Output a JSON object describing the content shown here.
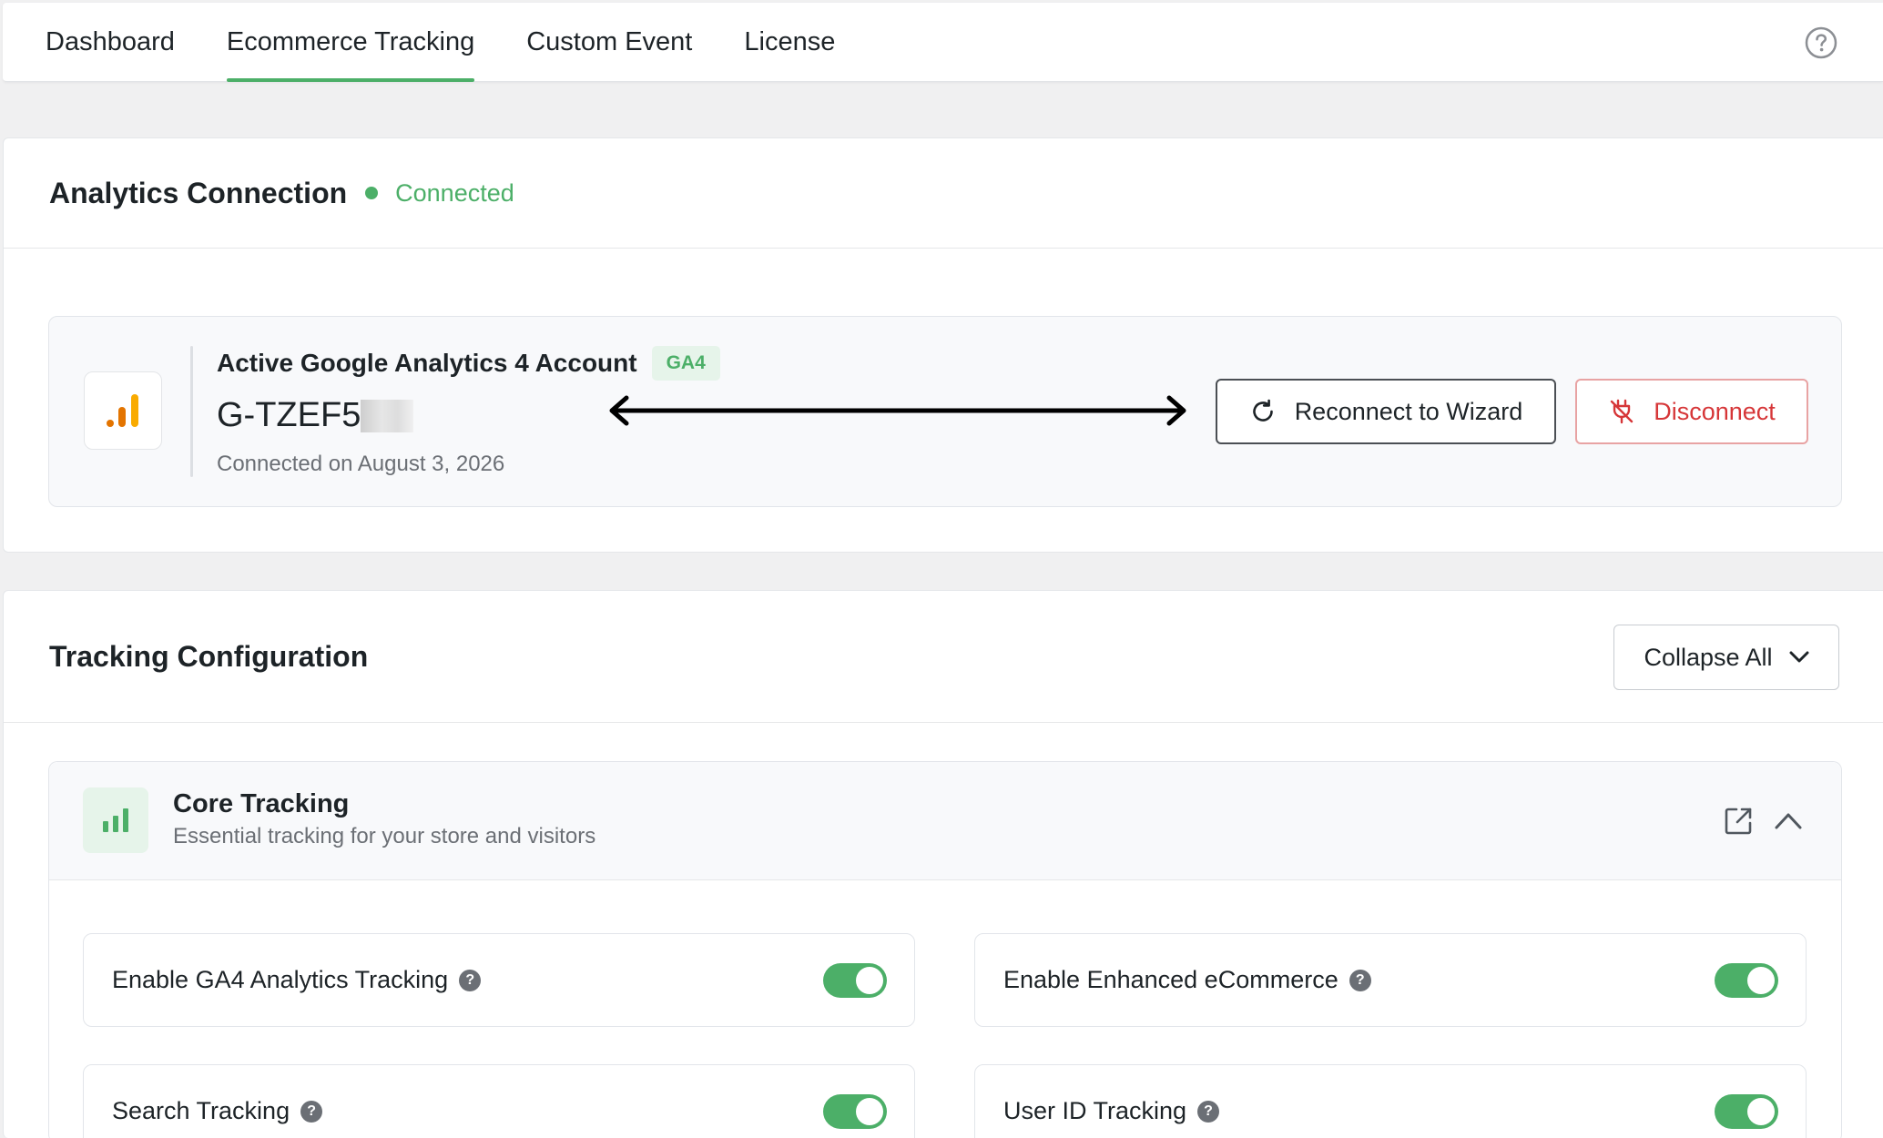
{
  "nav": {
    "tabs": [
      {
        "label": "Dashboard"
      },
      {
        "label": "Ecommerce Tracking",
        "active": true
      },
      {
        "label": "Custom Event"
      },
      {
        "label": "License"
      }
    ],
    "help_icon": "question-circle-icon"
  },
  "connection": {
    "title": "Analytics Connection",
    "status": "Connected",
    "status_color": "#4caf68",
    "account_label": "Active Google Analytics 4 Account",
    "badge": "GA4",
    "account_id": "G-TZEF5",
    "connected_on": "Connected on August 3, 2026",
    "reconnect_label": "Reconnect to Wizard",
    "disconnect_label": "Disconnect"
  },
  "tracking": {
    "title": "Tracking Configuration",
    "collapse_label": "Collapse All",
    "section": {
      "title": "Core Tracking",
      "subtitle": "Essential tracking for your store and visitors"
    },
    "options": [
      {
        "label": "Enable GA4 Analytics Tracking",
        "enabled": true
      },
      {
        "label": "Enable Enhanced eCommerce",
        "enabled": true
      },
      {
        "label": "Search Tracking",
        "enabled": true
      },
      {
        "label": "User ID Tracking",
        "enabled": true
      }
    ]
  },
  "colors": {
    "accent": "#4caf68",
    "danger": "#d63638",
    "ga_orange": "#e37400",
    "ga_yellow": "#f9ab00"
  }
}
